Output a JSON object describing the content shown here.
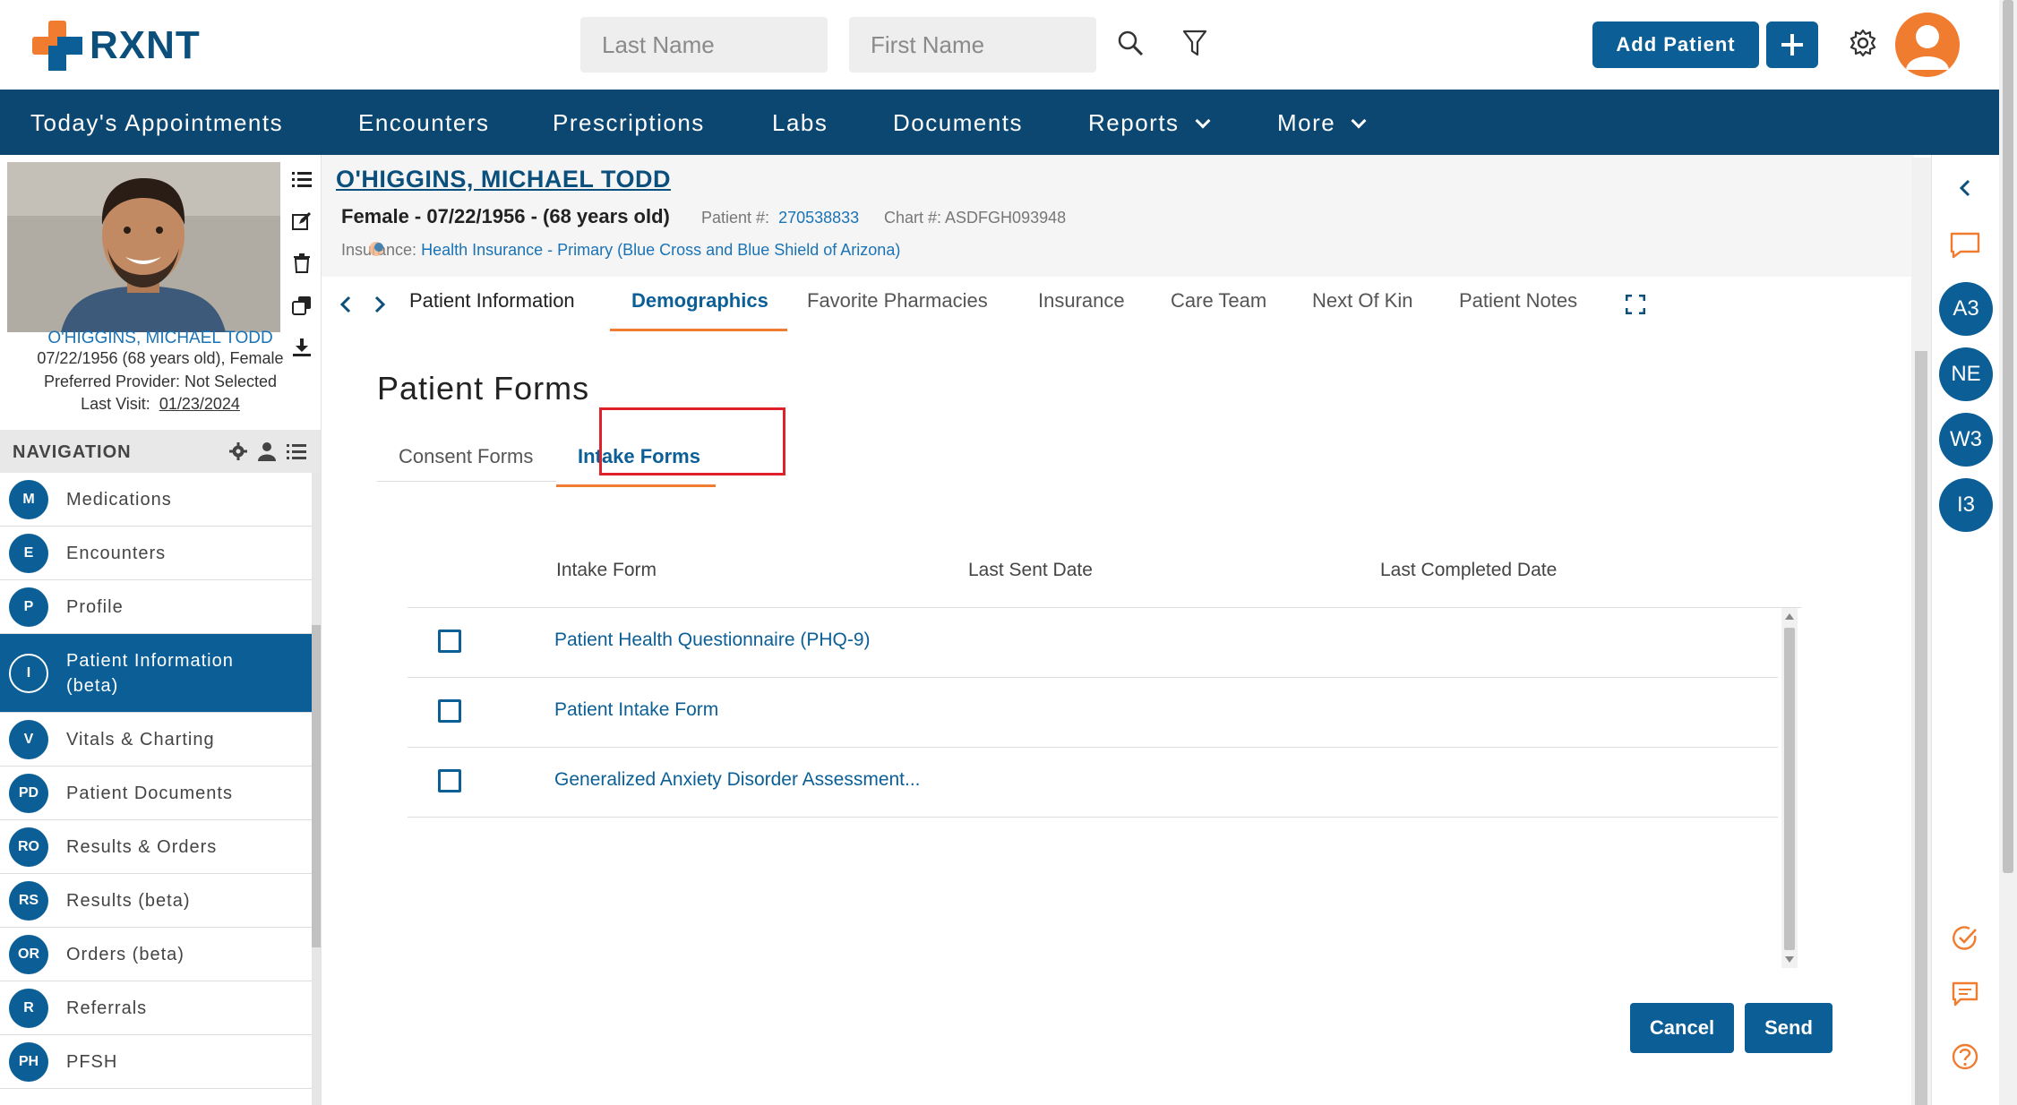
{
  "header": {
    "brand": "RXNT",
    "last_name_placeholder": "Last Name",
    "first_name_placeholder": "First Name",
    "add_patient_label": "Add Patient",
    "add_icon": "plus-icon",
    "settings_icon": "gear-icon",
    "search_icon": "search-icon",
    "filter_icon": "filter-icon"
  },
  "main_nav": {
    "items": [
      {
        "label": "Today's Appointments"
      },
      {
        "label": "Encounters"
      },
      {
        "label": "Prescriptions"
      },
      {
        "label": "Labs"
      },
      {
        "label": "Documents"
      },
      {
        "label": "Reports"
      },
      {
        "label": "More"
      }
    ]
  },
  "patient_card": {
    "name": "O'HIGGINS, MICHAEL TODD",
    "dob_line": "07/22/1956 (68 years old), Female",
    "provider_line": "Preferred Provider: Not Selected",
    "last_visit_label": "Last Visit:",
    "last_visit_date": "01/23/2024"
  },
  "navigation": {
    "title": "NAVIGATION",
    "items": [
      {
        "badge": "M",
        "label": "Medications"
      },
      {
        "badge": "E",
        "label": "Encounters"
      },
      {
        "badge": "P",
        "label": "Profile"
      },
      {
        "badge": "I",
        "label": "Patient Information (beta)",
        "active": true
      },
      {
        "badge": "V",
        "label": "Vitals & Charting"
      },
      {
        "badge": "PD",
        "label": "Patient Documents"
      },
      {
        "badge": "RO",
        "label": "Results & Orders"
      },
      {
        "badge": "RS",
        "label": "Results (beta)"
      },
      {
        "badge": "OR",
        "label": "Orders (beta)"
      },
      {
        "badge": "R",
        "label": "Referrals"
      },
      {
        "badge": "PH",
        "label": "PFSH"
      }
    ]
  },
  "patient_header": {
    "title": "O'HIGGINS, MICHAEL TODD",
    "subtitle": "Female - 07/22/1956 - (68 years old)",
    "patient_num_label": "Patient #:",
    "patient_num": "270538833",
    "chart_num_label": "Chart #:",
    "chart_num": "ASDFGH093948",
    "insurance_label": "Insurance:",
    "insurance_value": "Health Insurance - Primary (Blue Cross and Blue Shield of Arizona)"
  },
  "tabs": [
    {
      "label": "Patient Information"
    },
    {
      "label": "Demographics",
      "active": true
    },
    {
      "label": "Favorite Pharmacies"
    },
    {
      "label": "Insurance"
    },
    {
      "label": "Care Team"
    },
    {
      "label": "Next Of Kin"
    },
    {
      "label": "Patient Notes"
    }
  ],
  "forms": {
    "title": "Patient Forms",
    "subtabs": [
      {
        "label": "Consent Forms"
      },
      {
        "label": "Intake Forms",
        "active": true
      }
    ],
    "columns": [
      "Intake Form",
      "Last Sent Date",
      "Last Completed Date"
    ],
    "rows": [
      {
        "name": "Patient Health Questionnaire (PHQ-9)",
        "checked": false
      },
      {
        "name": "Patient Intake Form",
        "checked": false
      },
      {
        "name": "Generalized Anxiety Disorder Assessment...",
        "checked": false
      }
    ],
    "cancel_label": "Cancel",
    "send_label": "Send"
  },
  "right_rail": {
    "badges": [
      "A3",
      "NE",
      "W3",
      "I3"
    ]
  },
  "colors": {
    "brand_blue": "#0b5f96",
    "nav_dark": "#0b4770",
    "accent_orange": "#f07c30",
    "highlight_red": "#e0202a"
  }
}
